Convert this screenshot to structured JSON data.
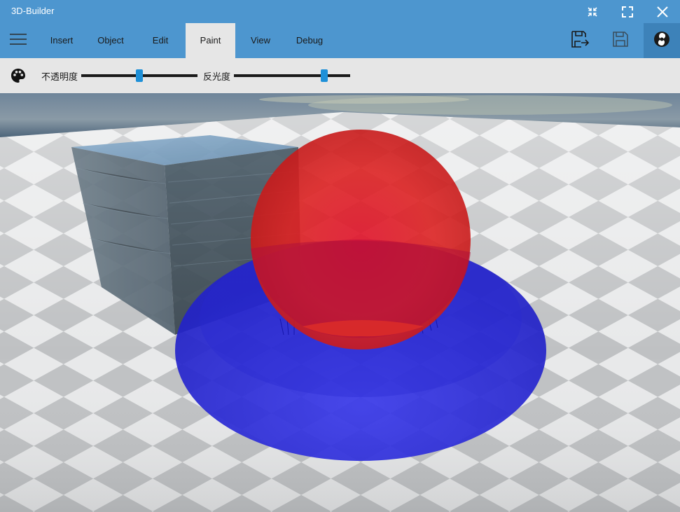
{
  "app": {
    "title": "3D-Builder"
  },
  "window_controls": [
    {
      "icon": "collapse-icon"
    },
    {
      "icon": "fullscreen-icon"
    },
    {
      "icon": "close-icon"
    }
  ],
  "ribbon": {
    "menu_icon": "hamburger-icon",
    "tabs": [
      {
        "label": "Insert"
      },
      {
        "label": "Object"
      },
      {
        "label": "Edit"
      },
      {
        "label": "Paint",
        "active": true
      },
      {
        "label": "View"
      },
      {
        "label": "Debug"
      }
    ],
    "actions": [
      {
        "icon": "save-as-icon"
      },
      {
        "icon": "save-icon"
      },
      {
        "icon": "account-icon"
      }
    ]
  },
  "paint_toolbar": {
    "palette_icon": "palette-icon",
    "opacity": {
      "label": "不透明度",
      "value": 0.5
    },
    "reflectivity": {
      "label": "反光度",
      "value": 0.78
    }
  },
  "scene": {
    "objects": [
      {
        "name": "cube",
        "material": "water-texture"
      },
      {
        "name": "sphere",
        "color": "#e01f1f"
      },
      {
        "name": "disc",
        "color": "#2a2ae0"
      }
    ],
    "ground": "checkerboard-plane",
    "environment": "sea-sky"
  },
  "colors": {
    "accent": "#4d96cf",
    "slider_thumb": "#1e90d8"
  }
}
